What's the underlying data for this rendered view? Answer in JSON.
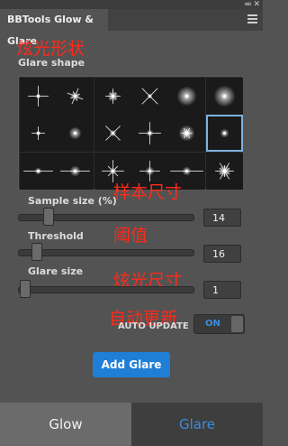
{
  "window": {
    "collapse_glyph": "««",
    "close_glyph": "✕"
  },
  "panel": {
    "title": "BBTools Glow & Glare",
    "menu_icon": "hamburger-menu-icon"
  },
  "annotations": {
    "glare_shape": "炫光形状",
    "sample_size": "样本尺寸",
    "threshold": "阈值",
    "glare_size": "炫光尺寸",
    "auto_update": "自动更新"
  },
  "glare_shape": {
    "label": "Glare shape",
    "selected_index": 11,
    "shapes": [
      "sharp-4-star-icon",
      "soft-star-burst-icon",
      "star-burst-icon",
      "cross-star-icon",
      "soft-round-glow-icon",
      "round-glow-icon",
      "small-4-star-icon",
      "soft-dot-glow-icon",
      "diagonal-star-icon",
      "cross-flare-icon",
      "fuzzy-burst-icon",
      "dot-glow-icon",
      "horizontal-flare-icon",
      "horizontal-dot-flare-icon",
      "star-flare-icon",
      "cross-burst-icon",
      "wide-horizontal-flare-icon",
      "spiky-burst-icon"
    ]
  },
  "sample_size": {
    "label": "Sample size (%)",
    "value": "14",
    "level": 0.14
  },
  "threshold": {
    "label": "Threshold",
    "value": "16",
    "level": 0.07
  },
  "glare_size": {
    "label": "Glare size",
    "value": "1",
    "level": 0.0
  },
  "auto_update": {
    "label": "AUTO UPDATE",
    "state": "ON"
  },
  "add_glare_button": "Add Glare",
  "bottom_tabs": [
    {
      "label": "Glow",
      "active": true
    },
    {
      "label": "Glare",
      "active": false
    }
  ],
  "colors": {
    "accent": "#1f7fd7",
    "annotation": "#ff2a1a",
    "glare_tab_text": "#3b8cde"
  }
}
